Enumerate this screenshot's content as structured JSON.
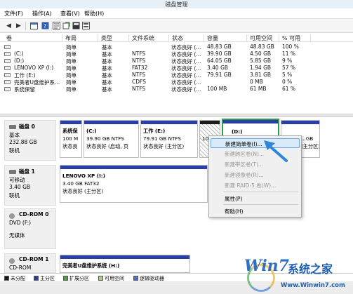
{
  "window": {
    "title": "磁盘管理"
  },
  "menu": [
    "文件(F)",
    "操作(A)",
    "查看(V)",
    "帮助(H)"
  ],
  "toolbar": [
    "back-icon",
    "forward-icon",
    "console-icon",
    "help-icon",
    "properties-icon",
    "refresh-icon",
    "export-icon",
    "view-icon"
  ],
  "table": {
    "headers": [
      "卷",
      "布局",
      "类型",
      "文件系统",
      "状态",
      "容量",
      "可用空间",
      "% 可用"
    ],
    "rows": [
      [
        "",
        "简单",
        "基本",
        "",
        "状态良好 (...",
        "48.83 GB",
        "48.83 GB",
        "100 %"
      ],
      [
        "(C:)",
        "简单",
        "基本",
        "NTFS",
        "状态良好 (...",
        "39.90 GB",
        "4.50 GB",
        "11 %"
      ],
      [
        "(D:)",
        "简单",
        "基本",
        "NTFS",
        "状态良好 (...",
        "64.05 GB",
        "5.85 GB",
        "9 %"
      ],
      [
        "LENOVO XP (I:)",
        "简单",
        "基本",
        "FAT32",
        "状态良好 (...",
        "3.40 GB",
        "1.94 GB",
        "57 %"
      ],
      [
        "工作 (E:)",
        "简单",
        "基本",
        "NTFS",
        "状态良好 (...",
        "79.91 GB",
        "3.81 GB",
        "5 %"
      ],
      [
        "完美者U盘维护系...",
        "简单",
        "基本",
        "CDFS",
        "状态良好 (...",
        "",
        "0 MB",
        "0 %"
      ],
      [
        "系统保留",
        "简单",
        "基本",
        "NTFS",
        "状态良好 (...",
        "100 MB",
        "61 MB",
        "61 %"
      ]
    ]
  },
  "disks": [
    {
      "name": "磁盘 0",
      "type": "基本",
      "size": "232.88 GB",
      "status": "联机",
      "parts": [
        {
          "title": "系统保",
          "l2": "100 M",
          "l3": "状态良"
        },
        {
          "title": "(C:)",
          "l2": "39.90 GB NTFS",
          "l3": "状态良好 (启动, 页"
        },
        {
          "title": "工作 (E:)",
          "l2": "79.91 GB NTFS",
          "l3": "状态良好 (主分区)"
        },
        {
          "title": "",
          "l2": "10",
          "l3": ""
        },
        {
          "title": "(D:)",
          "l2": "",
          "l3": ""
        },
        {
          "title": "",
          "l2": "...GB",
          "l3": "(主分区)"
        }
      ]
    },
    {
      "name": "磁盘 1",
      "type": "可移动",
      "size": "3.40 GB",
      "status": "联机",
      "parts": [
        {
          "title": "LENOVO XP (I:)",
          "l2": "3.40 GB FAT32",
          "l3": "状态良好 (主分区)"
        }
      ]
    },
    {
      "name": "CD-ROM 0",
      "type": "DVD (F:)",
      "size": "",
      "status": "无媒体",
      "parts": []
    },
    {
      "name": "CD-ROM 1",
      "type": "CD-ROM",
      "size": "",
      "status": "",
      "parts": [
        {
          "title": "完美者U盘维护系统 (H:)",
          "l2": "",
          "l3": ""
        }
      ]
    }
  ],
  "context_menu": {
    "items": [
      "新建简单卷(I)...",
      "新建跨区卷(N)...",
      "新建带区卷(T)...",
      "新建镜像卷(R)...",
      "新建 RAID-5 卷(W)...",
      "属性(P)",
      "帮助(H)"
    ]
  },
  "legend": [
    "未分配",
    "主分区",
    "扩展分区",
    "可用空间",
    "逻辑驱动器"
  ],
  "colors": {
    "primary": "#2a3ea8",
    "unallocated": "#1b1b1b",
    "extended": "#46a646",
    "free": "#a7d47a",
    "logical": "#4b6bd8"
  },
  "watermark": {
    "brand": "Win7",
    "cn": "系统之家",
    "url": "Www.Winwin7.com"
  }
}
